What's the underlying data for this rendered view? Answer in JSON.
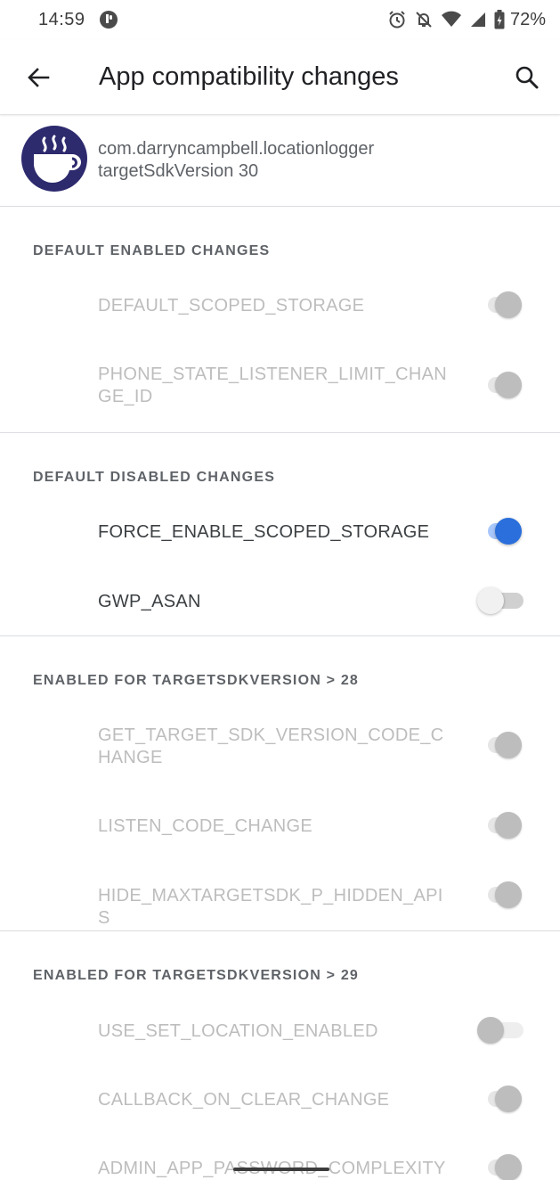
{
  "status_bar": {
    "time": "14:59",
    "battery_percent": "72%",
    "icons": [
      "alarm-icon",
      "do-not-disturb-icon",
      "wifi-icon",
      "signal-icon",
      "battery-charging-icon"
    ]
  },
  "app_bar": {
    "title": "App compatibility changes",
    "back_icon": "arrow-back-icon",
    "search_icon": "search-icon"
  },
  "app_header": {
    "package_name": "com.darryncampbell.locationlogger",
    "target_sdk": "targetSdkVersion 30",
    "icon": "coffee-cup-icon"
  },
  "colors": {
    "accent": "#2a6fdb",
    "accent_track": "#a8c7fa",
    "disabled_text": "#bdbdbd",
    "section_title": "#5f6368",
    "app_icon_bg": "#2d2a6e"
  },
  "sections": [
    {
      "title": "DEFAULT ENABLED CHANGES",
      "items": [
        {
          "label": "DEFAULT_SCOPED_STORAGE",
          "on": true,
          "enabled": false
        },
        {
          "label": "PHONE_STATE_LISTENER_LIMIT_CHANGE_ID",
          "on": true,
          "enabled": false
        }
      ]
    },
    {
      "title": "DEFAULT DISABLED CHANGES",
      "items": [
        {
          "label": "FORCE_ENABLE_SCOPED_STORAGE",
          "on": true,
          "enabled": true
        },
        {
          "label": "GWP_ASAN",
          "on": false,
          "enabled": true
        }
      ]
    },
    {
      "title": "ENABLED FOR TARGETSDKVERSION > 28",
      "items": [
        {
          "label": "GET_TARGET_SDK_VERSION_CODE_CHANGE",
          "on": true,
          "enabled": false
        },
        {
          "label": "LISTEN_CODE_CHANGE",
          "on": true,
          "enabled": false
        },
        {
          "label": "HIDE_MAXTARGETSDK_P_HIDDEN_APIS",
          "on": true,
          "enabled": false
        }
      ]
    },
    {
      "title": "ENABLED FOR TARGETSDKVERSION > 29",
      "items": [
        {
          "label": "USE_SET_LOCATION_ENABLED",
          "on": false,
          "enabled": false
        },
        {
          "label": "CALLBACK_ON_CLEAR_CHANGE",
          "on": true,
          "enabled": false
        },
        {
          "label": "ADMIN_APP_PASSWORD_COMPLEXITY",
          "on": true,
          "enabled": false
        }
      ]
    }
  ]
}
